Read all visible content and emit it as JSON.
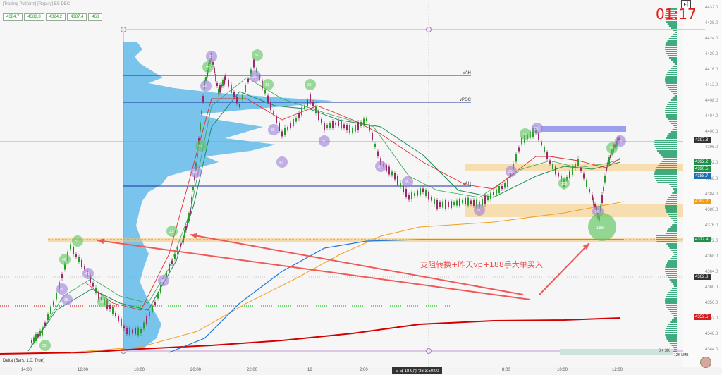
{
  "window": {
    "title": "[Trading Platform] [Replay] ES DEC",
    "clock": "01:17",
    "restore_label": "▸|"
  },
  "quote_boxes": [
    "4384.7",
    "4388.8",
    "4384.2",
    "4387.4",
    "463"
  ],
  "footer_label": "Delta (Bars, 1.0, True)",
  "annotation": "支阻转换+昨天vp+188手大单买入",
  "levels": {
    "vah": "VAH",
    "vpoc": "vPOC",
    "vah_cur": "VAH"
  },
  "xaxis": {
    "labels": [
      "14:00",
      "16:00",
      "18:00",
      "20:00",
      "22:00",
      "18",
      "2:00",
      "8:00",
      "10:00",
      "12:00"
    ],
    "cursor_time": "日日 18 9月 '26 3:50:00"
  },
  "yaxis": {
    "ticks": [
      "4432.0",
      "4428.0",
      "4424.0",
      "4420.0",
      "4416.0",
      "4412.0",
      "4408.0",
      "4404.0",
      "4400.0",
      "4396.0",
      "4392.0",
      "4388.0",
      "4384.0",
      "4380.0",
      "4376.0",
      "4372.0",
      "4368.0",
      "4364.0",
      "4360.0",
      "4356.0",
      "4352.0",
      "4348.0",
      "4344.0"
    ],
    "tags": [
      {
        "label": "4397.8",
        "color": "#333333"
      },
      {
        "label": "4392.2",
        "color": "#1f8f4a"
      },
      {
        "label": "4390.5",
        "color": "#1f8f4a"
      },
      {
        "label": "4388.7",
        "color": "#1f6fb5"
      },
      {
        "label": "4382.2",
        "color": "#f39c12"
      },
      {
        "label": "4372.4",
        "color": "#1f8f4a"
      },
      {
        "label": "4362.8",
        "color": "#333333"
      },
      {
        "label": "4352.5",
        "color": "#d32020"
      }
    ]
  },
  "bubbles": [
    "36",
    "35",
    "29",
    "40",
    "33",
    "41",
    "32",
    "35",
    "31",
    "42",
    "32",
    "35",
    "40",
    "37",
    "35",
    "35",
    "31",
    "35",
    "47",
    "35",
    "37",
    "37",
    "35",
    "37",
    "35",
    "37",
    "35",
    "188"
  ],
  "vol_footer": "3K 3K",
  "scale_tag": "12K LMB",
  "colors": {
    "up": "#2a9d2a",
    "down": "#9c2a6a",
    "profile": "#4fb3e8",
    "vah_line": "#1a2fa0",
    "support_zone": "#f5c56b",
    "resistance_zone": "#8888ee",
    "ema_red": "#e03030",
    "ema_orange": "#f0a020",
    "ema_blue": "#2277dd",
    "arrow": "#f05858"
  }
}
